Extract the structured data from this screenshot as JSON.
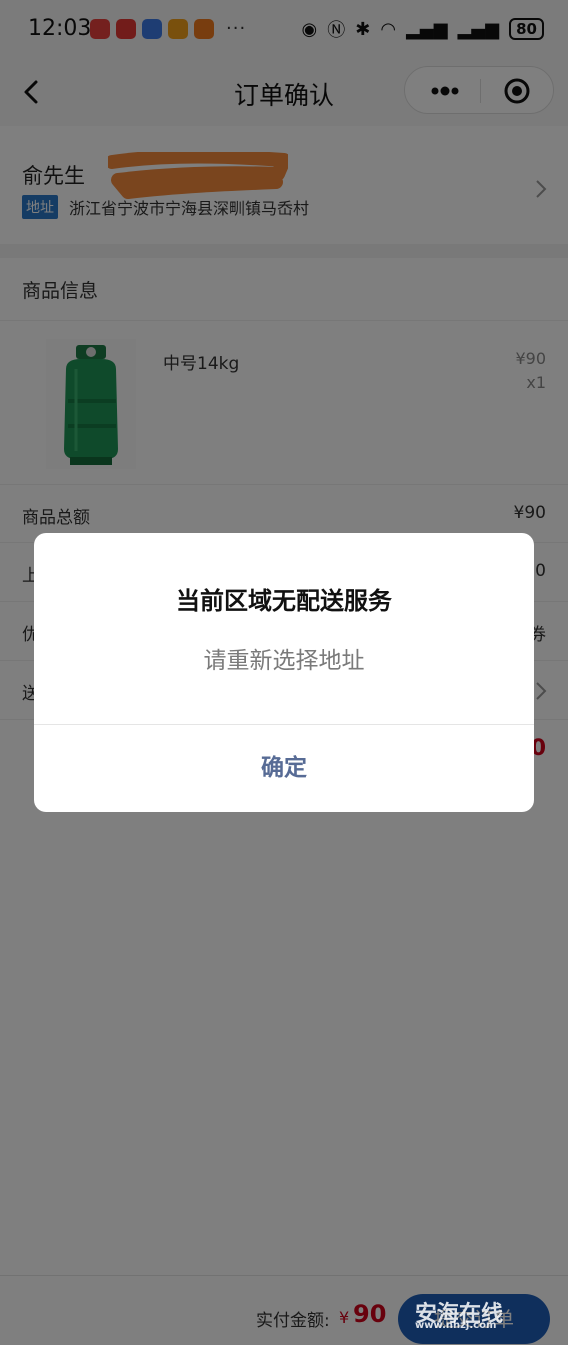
{
  "status_bar": {
    "time": "12:03",
    "more": "···",
    "battery": "80"
  },
  "nav": {
    "title": "订单确认"
  },
  "address": {
    "name": "俞先生",
    "tag": "地址",
    "detail": "浙江省宁波市宁海县深甽镇马岙村"
  },
  "goods": {
    "section_title": "商品信息",
    "product": {
      "name": "中号14kg",
      "price": "¥90",
      "quantity": "x1"
    }
  },
  "rows": [
    {
      "label": "商品总额",
      "value": "¥90"
    },
    {
      "label": "上",
      "value": "0"
    },
    {
      "label": "优",
      "value": "券"
    },
    {
      "label": "送",
      "value": ""
    }
  ],
  "partial_total": "0",
  "bottom_bar": {
    "pay_label": "实付金额:",
    "currency": "¥",
    "amount": "90",
    "submit_label": "提交订单"
  },
  "modal": {
    "title": "当前区域无配送服务",
    "message": "请重新选择地址",
    "confirm": "确定"
  },
  "watermark": {
    "text": "安海在线",
    "sub": "www.nhzj.com"
  },
  "colors": {
    "accent_red": "#d0021b",
    "button_blue": "#1f5fb8",
    "modal_button": "#576b95",
    "tag_blue": "#2a78c9"
  }
}
